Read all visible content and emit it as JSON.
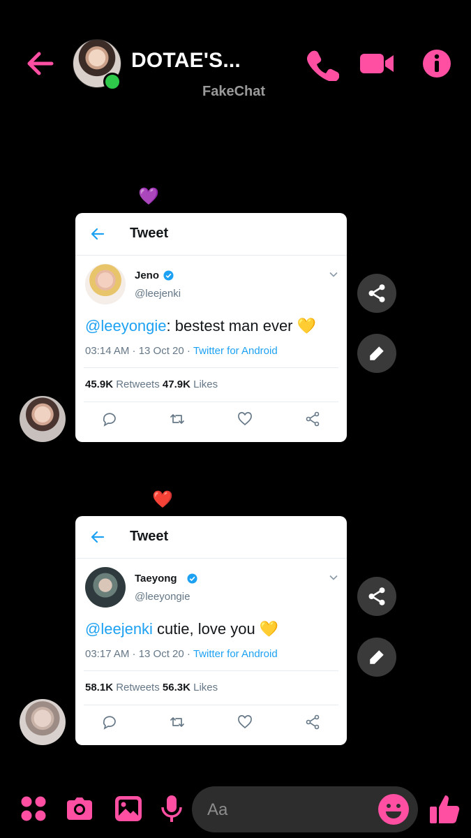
{
  "header": {
    "title": "DOTAE'S...",
    "subtitle": "FakeChat"
  },
  "colors": {
    "accent": "#ff4fa3",
    "background": "#000000",
    "link": "#1da1f2"
  },
  "messages": [
    {
      "reaction": "💜",
      "card_title": "Tweet",
      "name": "Jeno",
      "handle": "@leejenki",
      "mention": "@leeyongie",
      "text": ": bestest man ever",
      "emoji": "💛",
      "meta_time": "03:14 AM · 13 Oct 20 · ",
      "source": "Twitter for Android",
      "retweets": "45.9K",
      "retweets_label": " Retweets ",
      "likes": "47.9K",
      "likes_label": " Likes"
    },
    {
      "reaction": "❤️",
      "card_title": "Tweet",
      "name": "Taeyong",
      "handle": "@leeyongie",
      "mention": "@leejenki",
      "text": " cutie, love you",
      "emoji": "💛",
      "meta_time": "03:17 AM · 13 Oct 20 · ",
      "source": "Twitter for Android",
      "retweets": "58.1K",
      "retweets_label": " Retweets ",
      "likes": "56.3K",
      "likes_label": " Likes"
    }
  ],
  "composer": {
    "placeholder": "Aa"
  },
  "icons": [
    "back-arrow-icon",
    "phone-icon",
    "video-icon",
    "info-icon",
    "share-icon",
    "edit-icon",
    "apps-icon",
    "camera-icon",
    "image-icon",
    "mic-icon",
    "emoji-icon",
    "thumbs-up-icon"
  ]
}
